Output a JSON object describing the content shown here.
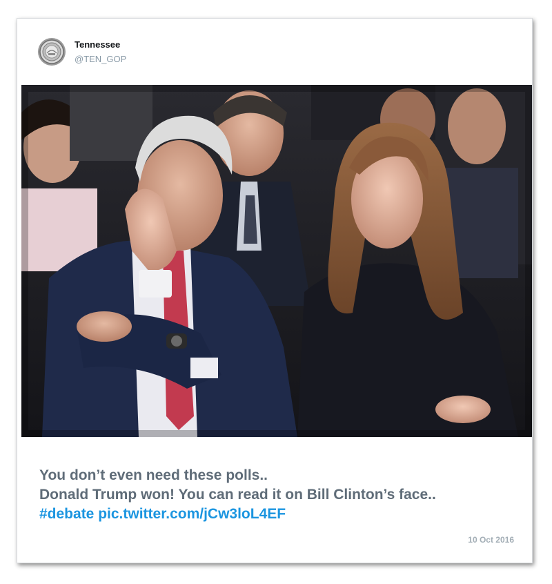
{
  "tweet": {
    "author": {
      "display_name": "Tennessee",
      "handle": "@TEN_GOP",
      "avatar_icon": "state-seal-icon"
    },
    "text_line_1": "You don’t even need these polls..",
    "text_line_2": "Donald Trump won! You can read it on Bill Clinton’s face..",
    "hashtag": "#debate",
    "link": "pic.twitter.com/jCw3loL4EF",
    "date": "10 Oct 2016"
  },
  "colors": {
    "text": "#5f6c78",
    "link": "#1b95e0",
    "handle": "#8899a6",
    "date": "#a3aeb6"
  }
}
